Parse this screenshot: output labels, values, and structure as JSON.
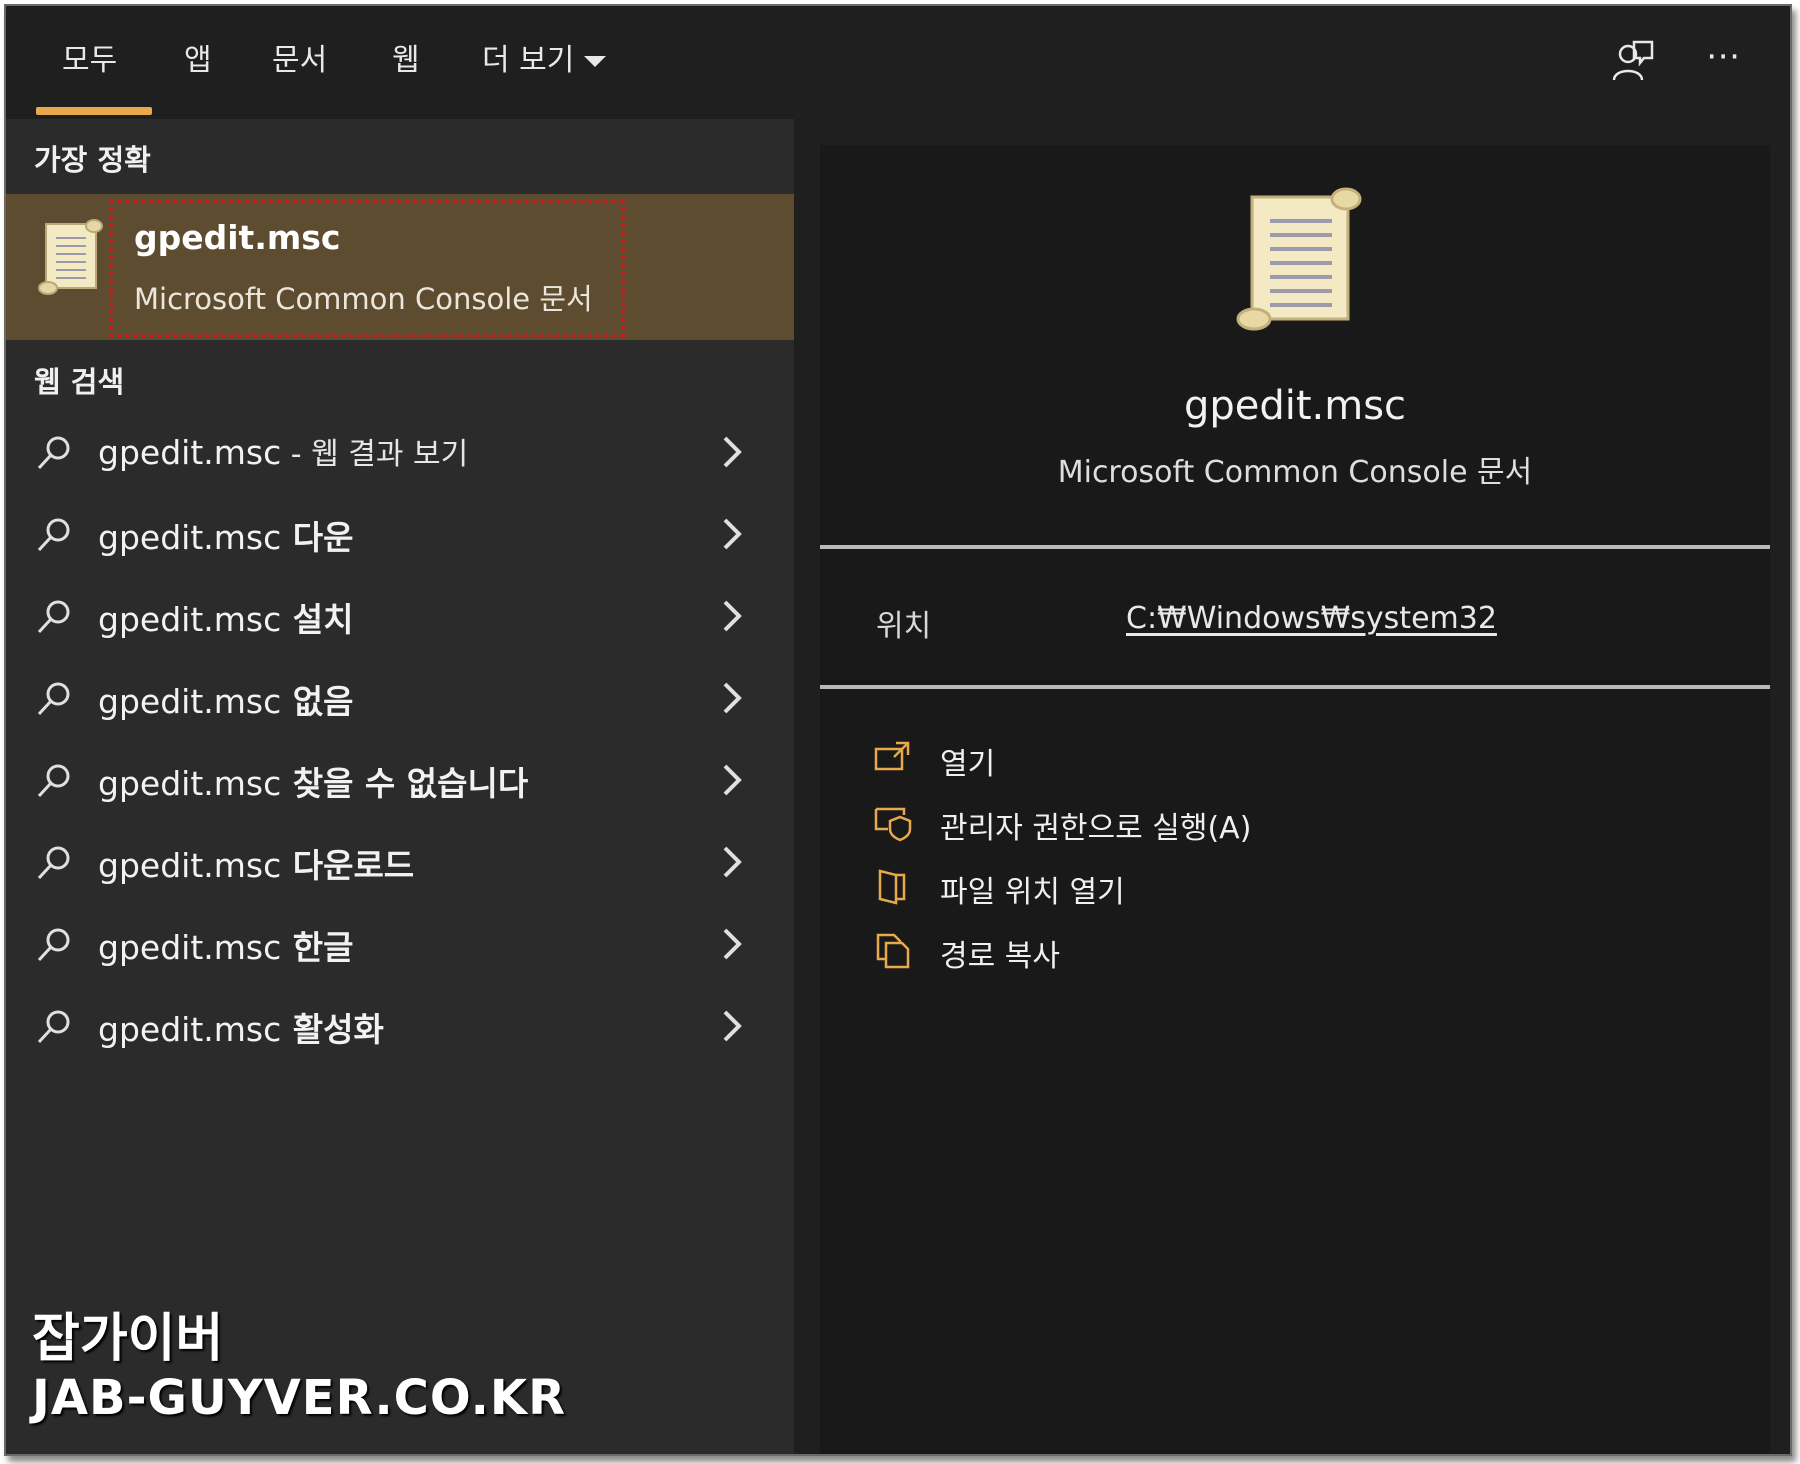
{
  "tabs": [
    {
      "label": "모두"
    },
    {
      "label": "앱"
    },
    {
      "label": "문서"
    },
    {
      "label": "웹"
    },
    {
      "label": "더 보기"
    }
  ],
  "top_icons": {
    "feedback": "feedback-person-icon",
    "more": "⋯"
  },
  "best_match": {
    "heading": "가장 정확",
    "title": "gpedit.msc",
    "subtitle": "Microsoft Common Console 문서"
  },
  "web_search": {
    "heading": "웹 검색",
    "items": [
      {
        "query": "gpedit.msc",
        "suffix": " - 웹 결과 보기"
      },
      {
        "query": "gpedit.msc",
        "suffix": " 다운"
      },
      {
        "query": "gpedit.msc",
        "suffix": " 설치"
      },
      {
        "query": "gpedit.msc",
        "suffix": " 없음"
      },
      {
        "query": "gpedit.msc",
        "suffix": " 찾을 수 없습니다"
      },
      {
        "query": "gpedit.msc",
        "suffix": " 다운로드"
      },
      {
        "query": "gpedit.msc",
        "suffix": " 한글"
      },
      {
        "query": "gpedit.msc",
        "suffix": " 활성화"
      }
    ]
  },
  "preview": {
    "title": "gpedit.msc",
    "subtitle": "Microsoft Common Console 문서",
    "location_label": "위치",
    "location_value": "C:₩Windows₩system32",
    "actions": [
      {
        "label": "열기",
        "icon": "open-icon"
      },
      {
        "label": "관리자 권한으로 실행(A)",
        "icon": "admin-shield-icon"
      },
      {
        "label": "파일 위치 열기",
        "icon": "folder-open-icon"
      },
      {
        "label": "경로 복사",
        "icon": "copy-icon"
      }
    ]
  },
  "watermark": {
    "line1": "잡가이버",
    "line2": "JAB-GUYVER.CO.KR"
  },
  "colors": {
    "accent": "#e7a94c",
    "best_match_bg": "#5e4c31",
    "highlight_box": "#d01a1a"
  }
}
